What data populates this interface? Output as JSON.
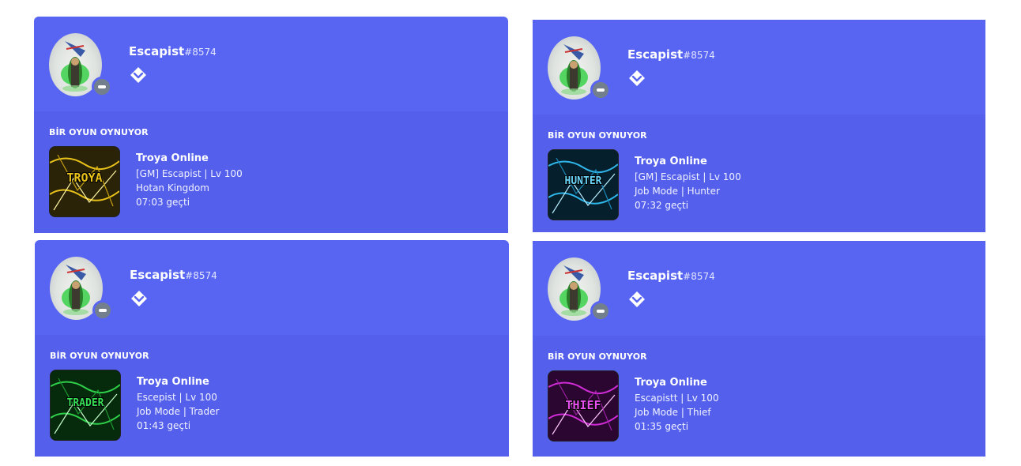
{
  "colors": {
    "card": "#5865f2",
    "card_body": "#5460eb",
    "status_idle": "#747f8d"
  },
  "cards": [
    {
      "username": "Escapist",
      "discriminator": "#8574",
      "section_label": "BİR OYUN OYNUYOR",
      "game_name": "Troya Online",
      "details": "[GM] Escapist | Lv 100",
      "state": "Hotan Kingdom",
      "elapsed": "07:03 geçti",
      "art_text": "TROYA",
      "art_color": "#e8c21a",
      "status_icon": "minus-circle-icon",
      "badge_icon": "hypesquad-icon"
    },
    {
      "username": "Escapist",
      "discriminator": "#8574",
      "section_label": "BİR OYUN OYNUYOR",
      "game_name": "Troya Online",
      "details": "[GM] Escapist | Lv 100",
      "state": "Job Mode | Hunter",
      "elapsed": "07:32 geçti",
      "art_text": "HUNTER",
      "art_color": "#2fb6ea",
      "status_icon": "minus-circle-icon",
      "badge_icon": "hypesquad-icon"
    },
    {
      "username": "Escapist",
      "discriminator": "#8574",
      "section_label": "BİR OYUN OYNUYOR",
      "game_name": "Troya Online",
      "details": "Escepist | Lv 100",
      "state": "Job Mode | Trader",
      "elapsed": "01:43 geçti",
      "art_text": "TRADER",
      "art_color": "#2fd04a",
      "status_icon": "minus-circle-icon",
      "badge_icon": "hypesquad-icon"
    },
    {
      "username": "Escapist",
      "discriminator": "#8574",
      "section_label": "BİR OYUN OYNUYOR",
      "game_name": "Troya Online",
      "details": "Escapistt | Lv 100",
      "state": "Job Mode | Thief",
      "elapsed": "01:35 geçti",
      "art_text": "THIEF",
      "art_color": "#d22bd8",
      "status_icon": "minus-circle-icon",
      "badge_icon": "hypesquad-icon"
    }
  ]
}
